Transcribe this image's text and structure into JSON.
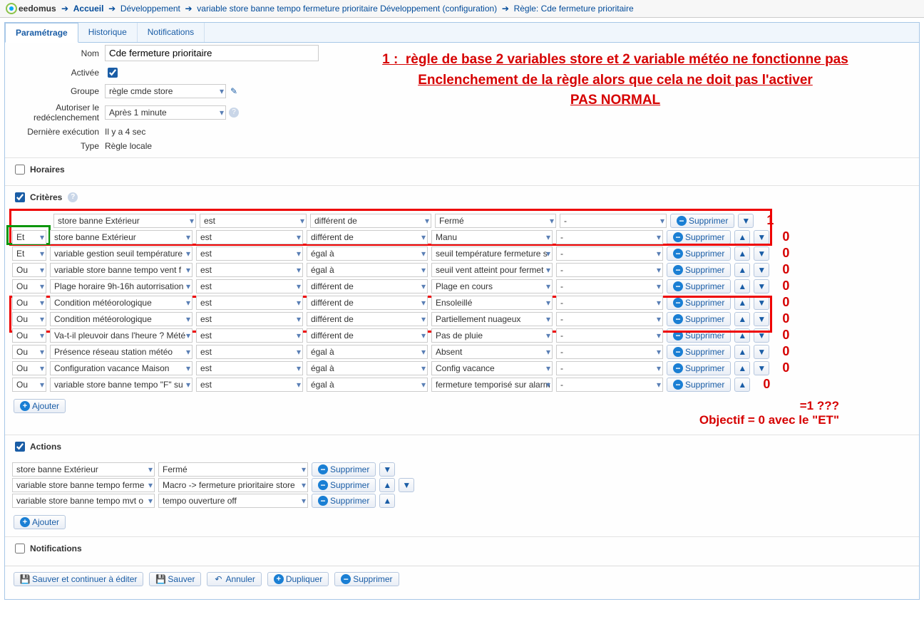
{
  "logo_text": "eedomus",
  "breadcrumbs": [
    "Accueil",
    "Développement",
    "variable store banne tempo fermeture prioritaire Développement (configuration)",
    "Règle: Cde fermeture prioritaire"
  ],
  "tabs": {
    "param": "Paramétrage",
    "hist": "Historique",
    "notif": "Notifications"
  },
  "form": {
    "name_label": "Nom",
    "name_value": "Cde fermeture prioritaire",
    "active_label": "Activée",
    "active_checked": true,
    "group_label": "Groupe",
    "group_value": "règle cmde store",
    "allow_label": "Autoriser le redéclenchement",
    "allow_value": "Après 1 minute",
    "last_exec_label": "Dernière exécution",
    "last_exec_value": "Il y a 4 sec",
    "type_label": "Type",
    "type_value": "Règle locale"
  },
  "annotation": {
    "line1_prefix": "1 :",
    "line1": "règle de base 2 variables store et 2 variable météo ne fonctionne pas",
    "line2": "Enclenchement de la règle alors que cela ne doit pas l'activer",
    "line3": "PAS NORMAL",
    "sum": "=1 ???",
    "obj": "Objectif = 0 avec le \"ET\""
  },
  "sections": {
    "horaires": "Horaires",
    "criteres": "Critères",
    "actions": "Actions",
    "notifications": "Notifications"
  },
  "btn_labels": {
    "supprimer": "Supprimer",
    "ajouter": "Ajouter",
    "sauver_cont": "Sauver et continuer à éditer",
    "sauver": "Sauver",
    "annuler": "Annuler",
    "dupliquer": "Dupliquer"
  },
  "criteria": [
    {
      "op": "",
      "device": "store banne Extérieur",
      "state": "est",
      "cmp": "différent de",
      "val": "Fermé",
      "extra": "-",
      "num": "1",
      "up": false,
      "down": true
    },
    {
      "op": "Et",
      "device": "store banne Extérieur",
      "state": "est",
      "cmp": "différent de",
      "val": "Manu",
      "extra": "-",
      "num": "0",
      "up": true,
      "down": true
    },
    {
      "op": "Et",
      "device": "variable gestion seuil température",
      "state": "est",
      "cmp": "égal à",
      "val": "seuil température fermeture s",
      "extra": "-",
      "num": "0",
      "up": true,
      "down": true
    },
    {
      "op": "Ou",
      "device": "variable store banne tempo vent f",
      "state": "est",
      "cmp": "égal à",
      "val": "seuil vent atteint pour fermet",
      "extra": "-",
      "num": "0",
      "up": true,
      "down": true
    },
    {
      "op": "Ou",
      "device": "Plage horaire 9h-16h autorrisation",
      "state": "est",
      "cmp": "différent de",
      "val": "Plage en cours",
      "extra": "-",
      "num": "0",
      "up": true,
      "down": true
    },
    {
      "op": "Ou",
      "device": "Condition météorologique",
      "state": "est",
      "cmp": "différent de",
      "val": "Ensoleillé",
      "extra": "-",
      "num": "0",
      "up": true,
      "down": true
    },
    {
      "op": "Ou",
      "device": "Condition météorologique",
      "state": "est",
      "cmp": "différent de",
      "val": "Partiellement nuageux",
      "extra": "-",
      "num": "0",
      "up": true,
      "down": true
    },
    {
      "op": "Ou",
      "device": "Va-t-il pleuvoir dans l'heure ? Mété",
      "state": "est",
      "cmp": "différent de",
      "val": "Pas de pluie",
      "extra": "-",
      "num": "0",
      "up": true,
      "down": true
    },
    {
      "op": "Ou",
      "device": "Présence réseau station météo",
      "state": "est",
      "cmp": "égal à",
      "val": "Absent",
      "extra": "-",
      "num": "0",
      "up": true,
      "down": true
    },
    {
      "op": "Ou",
      "device": "Configuration vacance Maison",
      "state": "est",
      "cmp": "égal à",
      "val": "Config vacance",
      "extra": "-",
      "num": "0",
      "up": true,
      "down": true
    },
    {
      "op": "Ou",
      "device": "variable store banne tempo \"F\" su",
      "state": "est",
      "cmp": "égal à",
      "val": "fermeture temporisé sur alarm",
      "extra": "-",
      "num": "0",
      "up": true,
      "down": false
    }
  ],
  "actions": [
    {
      "device": "store banne Extérieur",
      "value": "Fermé",
      "up": false,
      "down": true
    },
    {
      "device": "variable store banne tempo ferme",
      "value": "Macro -> fermeture prioritaire store",
      "up": true,
      "down": true
    },
    {
      "device": "variable store banne tempo mvt o",
      "value": "tempo ouverture off",
      "up": true,
      "down": false
    }
  ]
}
